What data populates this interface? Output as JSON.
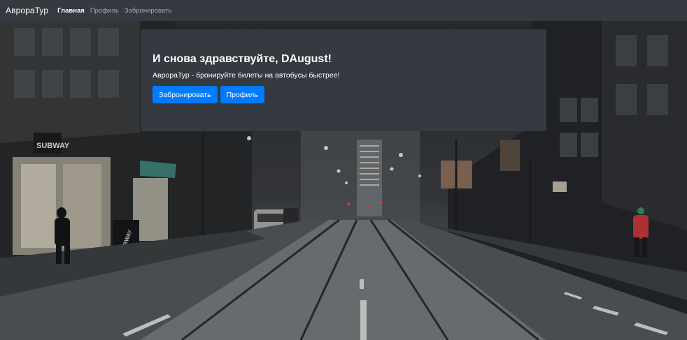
{
  "navbar": {
    "brand": "АврораТур",
    "links": [
      {
        "label": "Главная",
        "active": true
      },
      {
        "label": "Профиль",
        "active": false
      },
      {
        "label": "Забронировать",
        "active": false
      }
    ]
  },
  "jumbotron": {
    "title": "И снова здравствуйте, DAugust!",
    "lead": "АврораТур - бронируйте билеты на автобусы быстрее!",
    "buttons": {
      "book": "Забронировать",
      "profile": "Профиль"
    }
  },
  "background": {
    "signage": "SUBWAY"
  },
  "colors": {
    "navbar": "#343a40",
    "jumbotron": "#343a40",
    "primary": "#007bff"
  }
}
